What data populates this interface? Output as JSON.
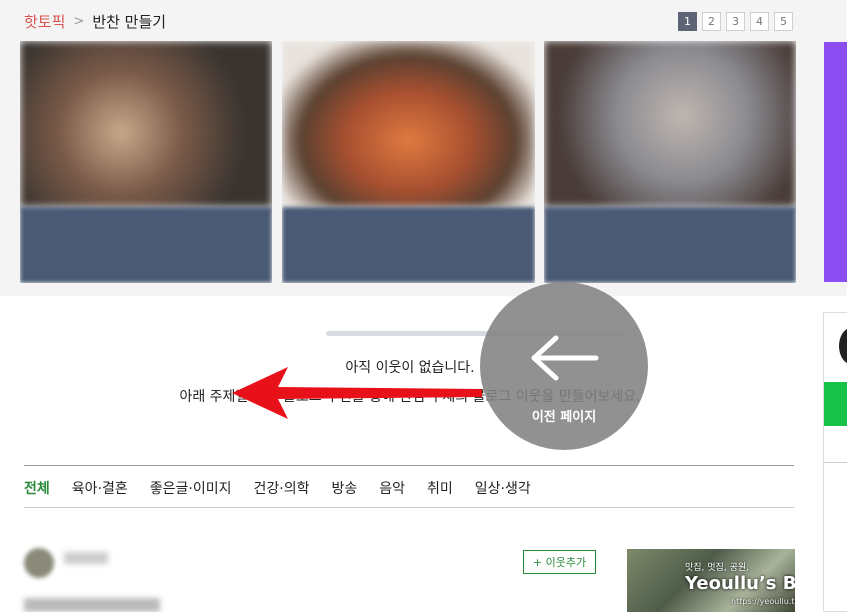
{
  "breadcrumb": {
    "hot": "핫토픽",
    "current": "반찬 만들기"
  },
  "pager": [
    "1",
    "2",
    "3",
    "4",
    "5"
  ],
  "cards": [
    {
      "caption_blurred": "",
      "colors": [
        "#3a3430",
        "#7a5a48",
        "#c9a98a"
      ]
    },
    {
      "caption_blurred": "",
      "colors": [
        "#2e2a24",
        "#a85030",
        "#e07a40"
      ]
    },
    {
      "caption_blurred": "",
      "colors": [
        "#4a3c38",
        "#8a8a90",
        "#c0b6b0"
      ]
    }
  ],
  "empty": {
    "line1": "아직 이웃이 없습니다.",
    "line2": "아래 주제별 추천 블로그 추천을 통해 관심 주제의 블로그 이웃을 만들어보세요."
  },
  "back_button": {
    "label": "이전 페이지",
    "icon": "arrow-left-icon"
  },
  "tabs": [
    "전체",
    "육아·결혼",
    "좋은글·이미지",
    "건강·의학",
    "방송",
    "음악",
    "취미",
    "일상·생각"
  ],
  "feed": {
    "add_button": "+ 이웃추가"
  },
  "watermark": {
    "small": "맛집, 멋집, 공원,",
    "title": "Yeoullu’s Blog",
    "url": "https://yeoullu.tistory.com"
  },
  "colors": {
    "accent_green": "#2a8a3a",
    "pager_active": "#5c6475",
    "side_purple": "#8b4cf0",
    "side_green": "#18c34a",
    "arrow_red": "#e8111a"
  }
}
